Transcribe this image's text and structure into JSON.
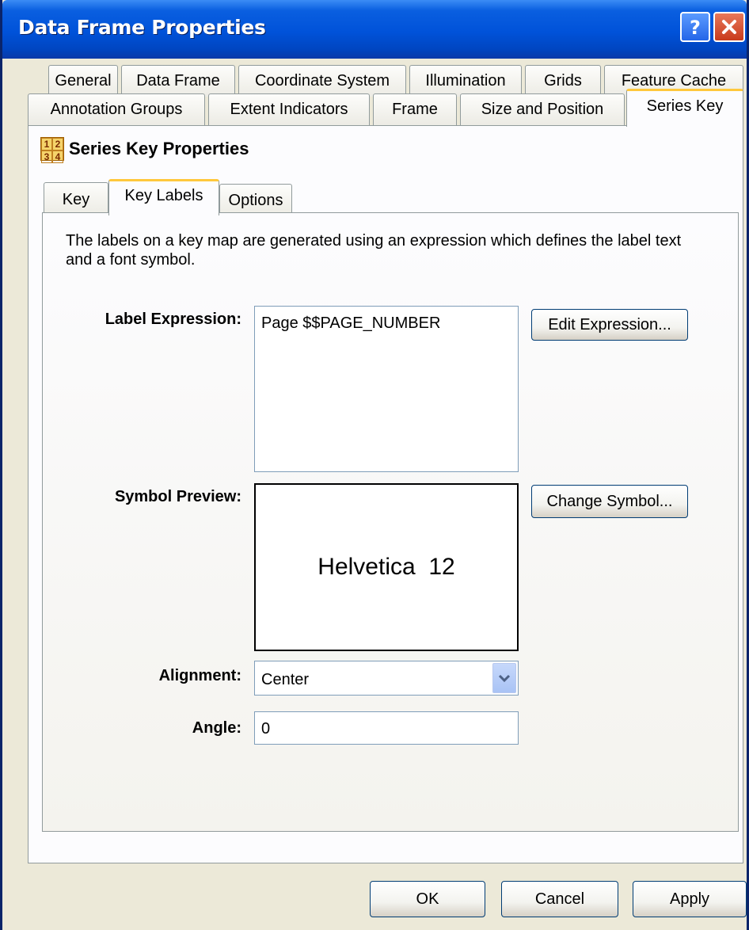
{
  "window": {
    "title": "Data Frame Properties"
  },
  "tabs_row1": [
    "General",
    "Data Frame",
    "Coordinate System",
    "Illumination",
    "Grids",
    "Feature Cache"
  ],
  "tabs_row2": [
    "Annotation Groups",
    "Extent Indicators",
    "Frame",
    "Size and Position",
    "Series Key"
  ],
  "selected_tab": "Series Key",
  "section": {
    "title": "Series Key Properties"
  },
  "inner_tabs": [
    "Key",
    "Key Labels",
    "Options"
  ],
  "selected_inner_tab": "Key Labels",
  "description": "The labels on a key map are generated using an expression which defines the label text and a font symbol.",
  "label_expression": {
    "label": "Label Expression:",
    "value": "Page $$PAGE_NUMBER",
    "button": "Edit Expression..."
  },
  "symbol_preview": {
    "label": "Symbol Preview:",
    "text": "Helvetica  12",
    "button": "Change Symbol..."
  },
  "alignment": {
    "label": "Alignment:",
    "value": "Center"
  },
  "angle": {
    "label": "Angle:",
    "value": "0"
  },
  "buttons": {
    "ok": "OK",
    "cancel": "Cancel",
    "apply": "Apply"
  },
  "colors": {
    "title_bar": "#0052d9",
    "selected_tab_accent": "#ffc83c",
    "dialog_bg": "#ece9d8"
  }
}
